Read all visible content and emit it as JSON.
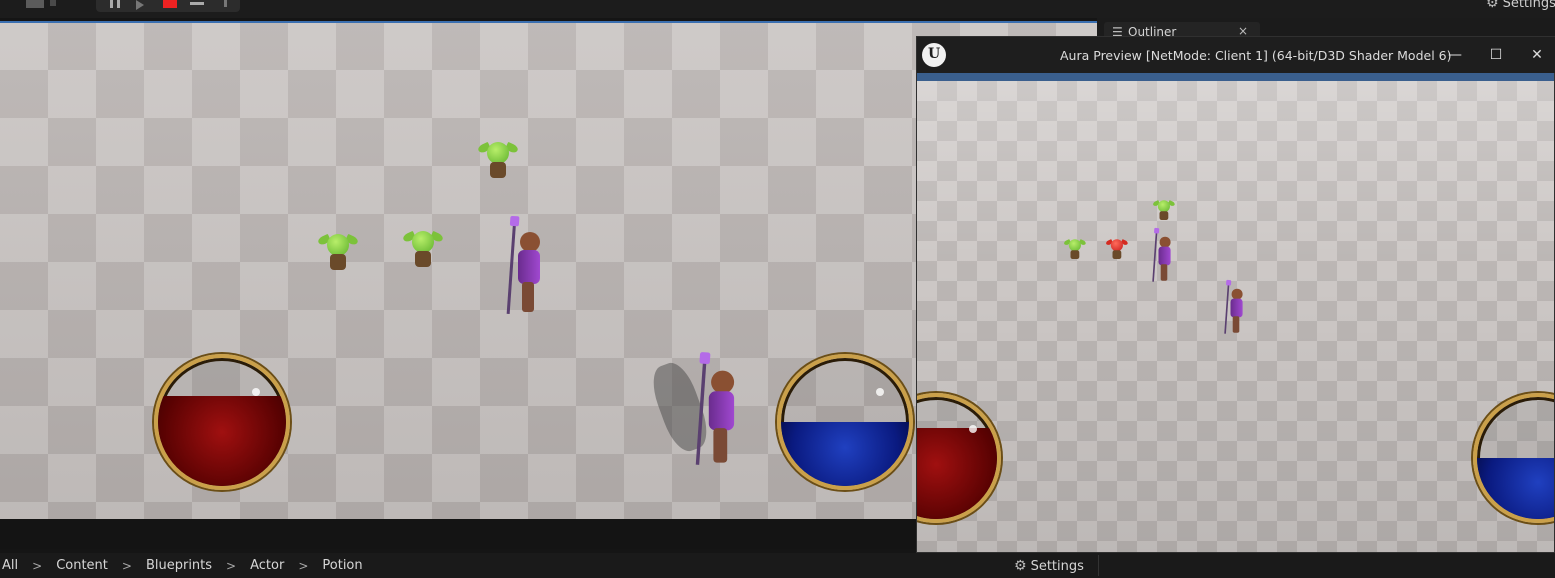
{
  "toolbar": {
    "settings_label": "Settings",
    "icons": [
      "layout-icon",
      "pause-icon",
      "step-icon",
      "stop-icon",
      "eject-icon",
      "more-icon",
      "gear-icon"
    ],
    "stop_color": "#e22222"
  },
  "outliner": {
    "tab_label": "Outliner",
    "close_glyph": "×"
  },
  "preview_window": {
    "title": "Aura Preview [NetMode: Client 1]  (64-bit/D3D Shader Model 6)",
    "minimize_glyph": "—",
    "maximize_glyph": "☐",
    "close_glyph": "✕"
  },
  "hud": {
    "health_fill": 0.7,
    "mana_fill": 0.5,
    "preview_health_fill": 0.75,
    "preview_mana_fill": 0.5,
    "health_color": "#8b0a0a",
    "mana_color": "#0a1a90",
    "frame_color": "#caa04a"
  },
  "content_browser": {
    "breadcrumbs": [
      "All",
      "Content",
      "Blueprints",
      "Actor",
      "Potion"
    ],
    "separator": ">",
    "settings_label": "Settings"
  },
  "colors": {
    "accent_blue": "#3a6fb0",
    "panel_bg": "#1a1a1a"
  }
}
